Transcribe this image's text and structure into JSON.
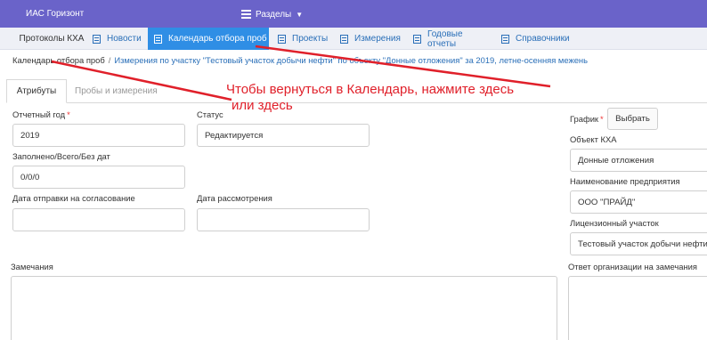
{
  "header": {
    "app_title": "ИАС Горизонт",
    "sections_label": "Разделы"
  },
  "nav": {
    "items": [
      {
        "label": "Протоколы КХА"
      },
      {
        "label": "Новости"
      },
      {
        "label": "Календарь отбора проб"
      },
      {
        "label": "Проекты"
      },
      {
        "label": "Измерения"
      },
      {
        "label": "Годовые отчеты"
      },
      {
        "label": "Справочники"
      }
    ]
  },
  "breadcrumb": {
    "root": "Календарь отбора проб",
    "separator": "/",
    "current": "Измерения по участку \"Тестовый участок добычи нефти\" по объекту \"Донные отложения\" за 2019, летне-осенняя межень"
  },
  "tabs": [
    {
      "label": "Атрибуты"
    },
    {
      "label": "Пробы и измерения"
    }
  ],
  "form": {
    "year": {
      "label": "Отчетный год",
      "required": "*",
      "value": "2019"
    },
    "status": {
      "label": "Статус",
      "value": "Редактируется"
    },
    "filled": {
      "label": "Заполнено/Всего/Без дат",
      "value": "0/0/0"
    },
    "send_date": {
      "label": "Дата отправки на согласование",
      "value": ""
    },
    "review_date": {
      "label": "Дата рассмотрения",
      "value": ""
    },
    "schedule": {
      "label": "График",
      "required": "*",
      "button": "Выбрать"
    },
    "object": {
      "label": "Объект КХА",
      "value": "Донные отложения"
    },
    "company": {
      "label": "Наименование предприятия",
      "value": "ООО \"ПРАЙД\""
    },
    "license": {
      "label": "Лицензионный участок",
      "value": "Тестовый участок добычи нефти"
    },
    "remarks": {
      "label": "Замечания",
      "value": ""
    },
    "response": {
      "label": "Ответ организации на замечания",
      "value": ""
    }
  },
  "annotation": {
    "line1": "Чтобы вернуться в Календарь, нажмите здесь",
    "line2": "или здесь",
    "color": "#e0202a"
  },
  "colors": {
    "header_bg": "#6a63c9",
    "active_tab_bg": "#2f8ee5",
    "link": "#2a6fb8"
  }
}
